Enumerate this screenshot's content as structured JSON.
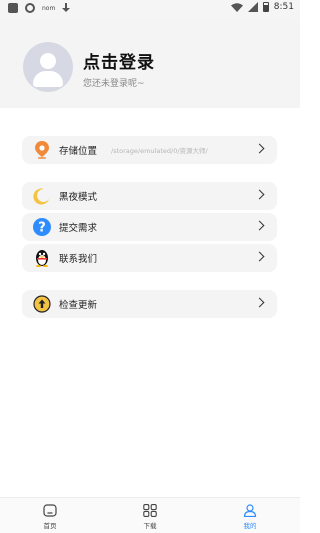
{
  "status_bar": {
    "left_text": "nom",
    "time": "8:51"
  },
  "header": {
    "title": "点击登录",
    "subtitle": "您还未登录呢~"
  },
  "menu": {
    "storage": {
      "label": "存储位置",
      "path": "/storage/emulated/0/资源大师/",
      "icon": "location-pin-icon"
    },
    "dark_mode": {
      "label": "黑夜模式",
      "icon": "moon-icon"
    },
    "submit": {
      "label": "提交需求",
      "icon": "question-icon"
    },
    "contact": {
      "label": "联系我们",
      "icon": "qq-penguin-icon"
    },
    "update": {
      "label": "检查更新",
      "icon": "upload-icon"
    }
  },
  "bottom_nav": {
    "items": [
      {
        "label": "首页",
        "icon": "home-icon"
      },
      {
        "label": "下载",
        "icon": "grid-icon"
      },
      {
        "label": "我的",
        "icon": "profile-icon"
      }
    ],
    "active_index": 2
  },
  "colors": {
    "accent": "#2f8cff",
    "row_bg": "#f4f4f4",
    "header_bg": "#f4f4f4"
  }
}
